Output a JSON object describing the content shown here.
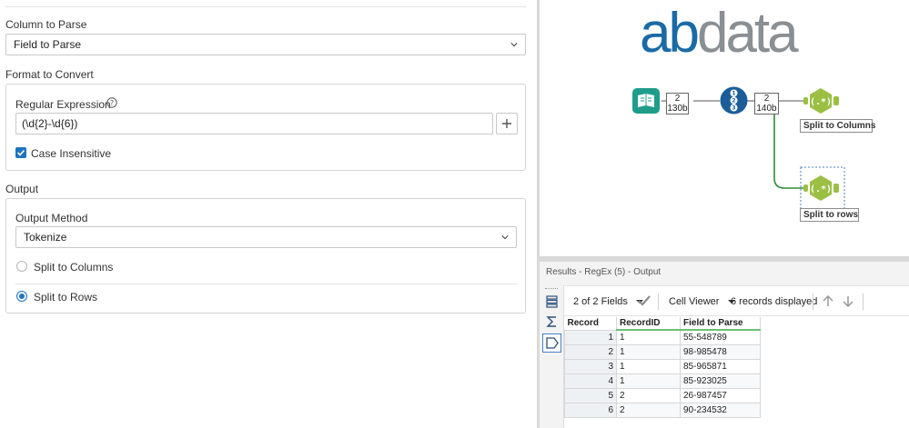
{
  "config": {
    "column_to_parse": {
      "title": "Column to Parse",
      "selected": "Field to Parse"
    },
    "format_to_convert": {
      "title": "Format to Convert",
      "regex_label": "Regular Expression",
      "regex_value": "(\\d{2}-\\d{6})",
      "case_insensitive_label": "Case Insensitive",
      "case_insensitive_checked": true
    },
    "output": {
      "title": "Output",
      "method_label": "Output Method",
      "method_selected": "Tokenize",
      "options": [
        {
          "label": "Split to Columns",
          "selected": false
        },
        {
          "label": "Split to Rows",
          "selected": true
        }
      ]
    }
  },
  "canvas": {
    "logo": {
      "part1": "ab",
      "part2": "data"
    },
    "input_count": {
      "records": "2",
      "size": "130b"
    },
    "record_id_count": {
      "records": "2",
      "size": "140b"
    },
    "tool_labels": {
      "split_columns": "Split  to Columns",
      "split_rows": "Split to rows"
    },
    "colors": {
      "input_tool": "#1f9d8a",
      "record_id_tool": "#1a5d99",
      "regex_tool": "#9bbf43",
      "connector": "#2e8b3a"
    }
  },
  "results": {
    "title": "Results - RegEx (5) - Output",
    "fields_summary": "2 of 2 Fields",
    "viewer": "Cell Viewer",
    "records_displayed": "6 records displayed",
    "columns": [
      "Record",
      "RecordID",
      "Field to Parse"
    ],
    "rows": [
      {
        "record": "1",
        "record_id": "1",
        "field": "55-548789"
      },
      {
        "record": "2",
        "record_id": "1",
        "field": "98-985478"
      },
      {
        "record": "3",
        "record_id": "1",
        "field": "85-965871"
      },
      {
        "record": "4",
        "record_id": "1",
        "field": "85-923025"
      },
      {
        "record": "5",
        "record_id": "2",
        "field": "26-987457"
      },
      {
        "record": "6",
        "record_id": "2",
        "field": "90-234532"
      }
    ]
  }
}
